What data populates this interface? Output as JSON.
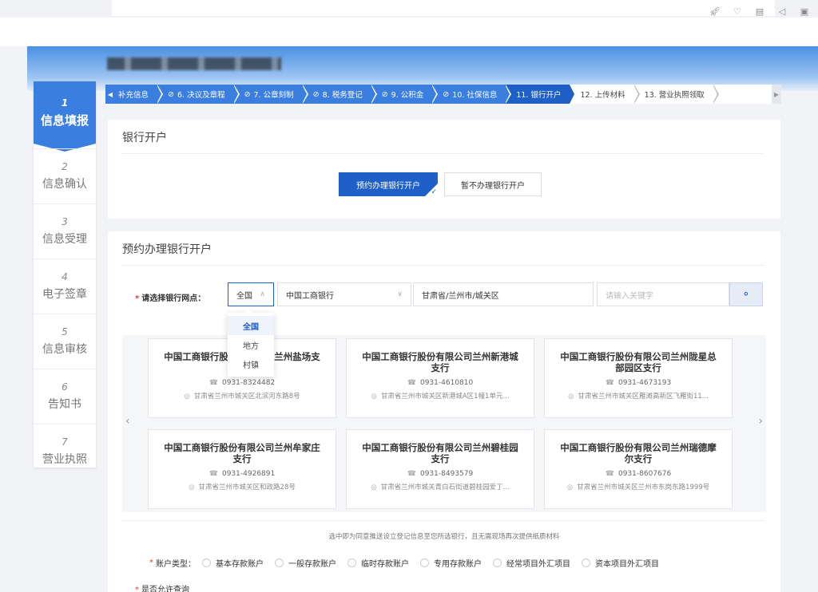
{
  "toolbar_icons": [
    "rocket-icon",
    "heart-icon",
    "trash-icon",
    "speaker-icon",
    "window-icon"
  ],
  "steps": [
    {
      "num": "1",
      "label": "信息填报",
      "active": true
    },
    {
      "num": "2",
      "label": "信息确认"
    },
    {
      "num": "3",
      "label": "信息受理"
    },
    {
      "num": "4",
      "label": "电子签章"
    },
    {
      "num": "5",
      "label": "信息审核"
    },
    {
      "num": "6",
      "label": "告知书"
    },
    {
      "num": "7",
      "label": "营业执照"
    }
  ],
  "crumbs": [
    {
      "label": "补充信息",
      "state": "done"
    },
    {
      "label": "6. 决议及章程",
      "state": "done"
    },
    {
      "label": "7. 公章刻制",
      "state": "done"
    },
    {
      "label": "8. 税务登记",
      "state": "done"
    },
    {
      "label": "9. 公积金",
      "state": "done"
    },
    {
      "label": "10. 社保信息",
      "state": "done"
    },
    {
      "label": "11. 银行开户",
      "state": "current"
    },
    {
      "label": "12. 上传材料",
      "state": "todo"
    },
    {
      "label": "13. 营业执照领取",
      "state": "todo"
    }
  ],
  "bank_section": {
    "title": "银行开户",
    "btn_yes": "预约办理银行开户",
    "btn_no": "暂不办理银行开户"
  },
  "reserve_section": {
    "title": "预约办理银行开户",
    "select_label": "请选择银行网点：",
    "scope": "全国",
    "bank": "中国工商银行",
    "region": "甘肃省/兰州市/城关区",
    "keyword_placeholder": "请输入关键字",
    "dropdown": [
      "全国",
      "地方",
      "村镇"
    ]
  },
  "cards": [
    {
      "name": "中国工商银行股份有限公司兰州盐场支行",
      "phone": "0931-8324482",
      "addr": "甘肃省兰州市城关区北滨河东路8号"
    },
    {
      "name": "中国工商银行股份有限公司兰州新港城支行",
      "phone": "0931-4610810",
      "addr": "甘肃省兰州市城关区新港城A区1幢1单元..."
    },
    {
      "name": "中国工商银行股份有限公司兰州陇星总部园区支行",
      "phone": "0931-4673193",
      "addr": "甘肃省兰州市城关区雁滩高新区飞雁街11..."
    },
    {
      "name": "中国工商银行股份有限公司兰州牟家庄支行",
      "phone": "0931-4926891",
      "addr": "甘肃省兰州市城关区和政路28号"
    },
    {
      "name": "中国工商银行股份有限公司兰州碧桂园支行",
      "phone": "0931-8493579",
      "addr": "甘肃省兰州市城关青白石街道碧桂园爱丁..."
    },
    {
      "name": "中国工商银行股份有限公司兰州瑞德摩尔支行",
      "phone": "0931-8607676",
      "addr": "甘肃省兰州市城关区兰州市东岗东路1999号"
    }
  ],
  "notice": "选中即为同意推送设立登记信息至您所选银行，且无需现场再次提供纸质材料",
  "account_type": {
    "label": "账户类型：",
    "options": [
      "基本存款账户",
      "一般存款账户",
      "临时存款账户",
      "专用存款账户",
      "经常项目外汇项目",
      "资本项目外汇项目"
    ]
  },
  "last_label": "是否允许查询"
}
